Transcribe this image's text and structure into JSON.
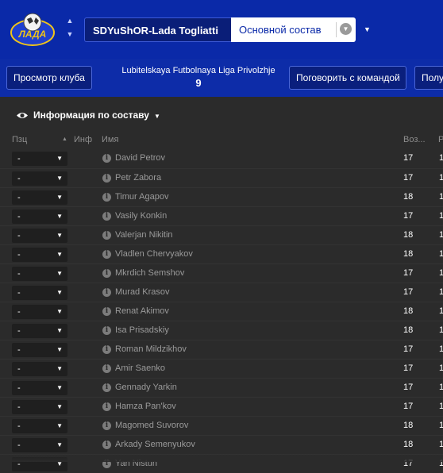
{
  "header": {
    "club_name": "SDYuShOR-Lada Togliatti",
    "squad_view": "Основной состав",
    "logo_text": "ЛАДА"
  },
  "toolbar": {
    "view_club": "Просмотр клуба",
    "league_name": "Lubitelskaya Futbolnaya Liga Privolzhje",
    "league_position": "9",
    "talk_to_team": "Поговорить с командой",
    "get_more": "Полу"
  },
  "section": {
    "title": "Информация по составу"
  },
  "table": {
    "columns": {
      "pos": "Пзц",
      "inf": "Инф",
      "name": "Имя",
      "age": "Воз...",
      "more": "Р"
    },
    "rows": [
      {
        "pos": "-",
        "name": "David Petrov",
        "age": "17",
        "extra": "1"
      },
      {
        "pos": "-",
        "name": "Petr Zabora",
        "age": "17",
        "extra": "1"
      },
      {
        "pos": "-",
        "name": "Timur Agapov",
        "age": "18",
        "extra": "1"
      },
      {
        "pos": "-",
        "name": "Vasily Konkin",
        "age": "17",
        "extra": "1"
      },
      {
        "pos": "-",
        "name": "Valerjan Nikitin",
        "age": "18",
        "extra": "1"
      },
      {
        "pos": "-",
        "name": "Vladlen Chervyakov",
        "age": "18",
        "extra": "1"
      },
      {
        "pos": "-",
        "name": "Mkrdich Semshov",
        "age": "17",
        "extra": "1"
      },
      {
        "pos": "-",
        "name": "Murad Krasov",
        "age": "17",
        "extra": "1"
      },
      {
        "pos": "-",
        "name": "Renat Akimov",
        "age": "18",
        "extra": "1"
      },
      {
        "pos": "-",
        "name": "Isa Prisadskiy",
        "age": "18",
        "extra": "1"
      },
      {
        "pos": "-",
        "name": "Roman Mildzikhov",
        "age": "17",
        "extra": "1"
      },
      {
        "pos": "-",
        "name": "Amir Saenko",
        "age": "17",
        "extra": "1"
      },
      {
        "pos": "-",
        "name": "Gennady Yarkin",
        "age": "17",
        "extra": "1"
      },
      {
        "pos": "-",
        "name": "Hamza Pan'kov",
        "age": "17",
        "extra": "1"
      },
      {
        "pos": "-",
        "name": "Magomed Suvorov",
        "age": "18",
        "extra": "1"
      },
      {
        "pos": "-",
        "name": "Arkady Semenyukov",
        "age": "18",
        "extra": "1"
      },
      {
        "pos": "-",
        "name": "Yan Nistun",
        "age": "17",
        "extra": "1"
      }
    ]
  }
}
